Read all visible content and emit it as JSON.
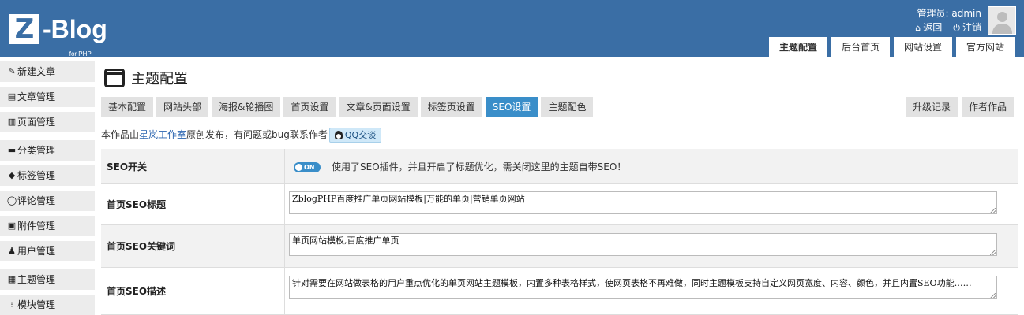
{
  "header": {
    "logo_letter": "Z",
    "logo_text": "Z-Blog",
    "logo_sub": "for PHP",
    "admin_label": "管理员: admin",
    "back_label": "返回",
    "logout_label": "注销",
    "accent_color": "#3a6ea5",
    "tabs": [
      {
        "label": "主题配置",
        "active": true
      },
      {
        "label": "后台首页",
        "active": false
      },
      {
        "label": "网站设置",
        "active": false
      },
      {
        "label": "官方网站",
        "active": false
      }
    ]
  },
  "sidebar": {
    "items": [
      {
        "label": "新建文章",
        "icon": "edit-icon"
      },
      {
        "label": "文章管理",
        "icon": "article-icon"
      },
      {
        "label": "页面管理",
        "icon": "page-icon"
      },
      {
        "label": "分类管理",
        "icon": "folder-icon"
      },
      {
        "label": "标签管理",
        "icon": "tag-icon"
      },
      {
        "label": "评论管理",
        "icon": "comment-icon"
      },
      {
        "label": "附件管理",
        "icon": "attachment-icon"
      },
      {
        "label": "用户管理",
        "icon": "user-icon"
      },
      {
        "label": "主题管理",
        "icon": "theme-icon"
      },
      {
        "label": "模块管理",
        "icon": "module-icon"
      }
    ]
  },
  "main": {
    "page_title": "主题配置",
    "sub_tabs": [
      {
        "label": "基本配置",
        "active": false
      },
      {
        "label": "网站头部",
        "active": false
      },
      {
        "label": "海报&轮播图",
        "active": false
      },
      {
        "label": "首页设置",
        "active": false
      },
      {
        "label": "文章&页面设置",
        "active": false
      },
      {
        "label": "标签页设置",
        "active": false
      },
      {
        "label": "SEO设置",
        "active": true
      },
      {
        "label": "主题配色",
        "active": false
      }
    ],
    "right_tabs": [
      {
        "label": "升级记录"
      },
      {
        "label": "作者作品"
      }
    ],
    "notice_prefix": "本作品由",
    "notice_link": "星岚工作室",
    "notice_suffix": "原创发布，有问题或bug联系作者",
    "qq_label": "QQ交谈",
    "settings": {
      "seo_switch": {
        "label": "SEO开关",
        "toggle_text": "ON",
        "toggle_on": true,
        "description": "使用了SEO插件，并且开启了标题优化，需关闭这里的主题自带SEO！"
      },
      "home_title": {
        "label": "首页SEO标题",
        "value": "ZblogPHP百度推广单页网站模板|万能的单页|营销单页网站"
      },
      "home_keywords": {
        "label": "首页SEO关键词",
        "value": "单页网站模板,百度推广单页"
      },
      "home_description": {
        "label": "首页SEO描述",
        "value": "针对需要在网站做表格的用户重点优化的单页网站主题模板，内置多种表格样式，使网页表格不再难做，同时主题模板支持自定义网页宽度、内容、颜色，并且内置SEO功能……"
      }
    }
  }
}
